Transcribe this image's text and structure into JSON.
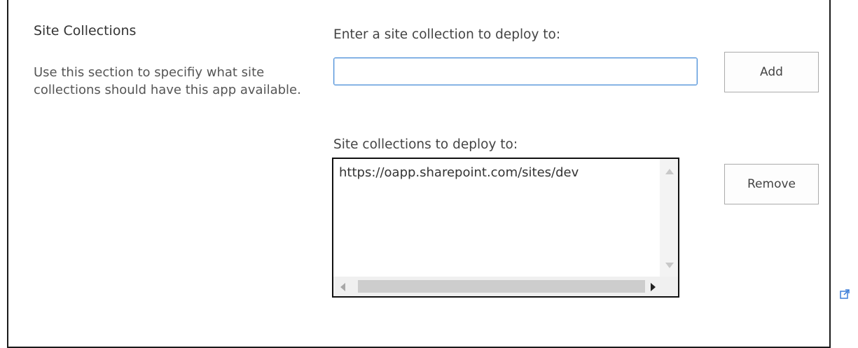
{
  "section": {
    "title": "Site Collections",
    "description": "Use this section to specifiy what site collections should have this app available."
  },
  "input": {
    "label": "Enter a site collection to deploy to:",
    "value": "",
    "placeholder": ""
  },
  "buttons": {
    "add_label": "Add",
    "remove_label": "Remove"
  },
  "list": {
    "label": "Site collections to deploy to:",
    "items": [
      "https://oapp.sharepoint.com/sites/dev"
    ]
  },
  "icons": {
    "expand": "external-link-icon",
    "scroll_up": "scroll-up-arrow-icon",
    "scroll_down": "scroll-down-arrow-icon",
    "scroll_left": "scroll-left-arrow-icon",
    "scroll_right": "scroll-right-arrow-icon"
  },
  "colors": {
    "input_focus_border": "#4a8ed8",
    "text": "#444444",
    "panel_border": "#1a1a1a",
    "icon_accent": "#3b7dd8"
  }
}
